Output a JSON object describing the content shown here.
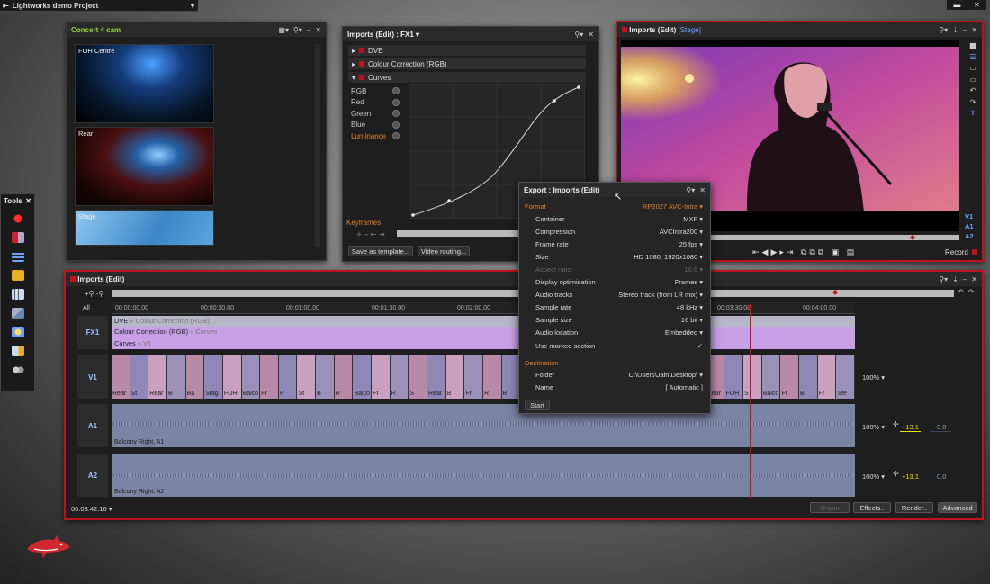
{
  "app": {
    "project_title": "Lightworks demo Project"
  },
  "colors": {
    "accent_red": "#c0121c",
    "orange": "#e0802a",
    "fx_purple": "#c9a0e8",
    "level_yellow": "#e6e600"
  },
  "concert": {
    "title": "Concert 4 cam",
    "tiles": [
      "FOH Centre",
      "Rear",
      "Stage"
    ]
  },
  "fxpanel": {
    "title": "Imports (Edit) : FX1",
    "effects": [
      "DVE",
      "Colour Correction (RGB)",
      "Curves"
    ],
    "channels": [
      "RGB",
      "Red",
      "Green",
      "Blue",
      "Luminance"
    ],
    "keyframes_label": "Keyframes",
    "buttons": [
      "Save as template...",
      "Video routing..."
    ]
  },
  "viewer": {
    "title": "Imports (Edit)",
    "stage_label": "[Stage]",
    "tracks": [
      "V1",
      "A1",
      "A2"
    ],
    "record_label": "Record"
  },
  "tools": {
    "title": "Tools"
  },
  "export": {
    "title": "Export : Imports (Edit)",
    "format_label": "Format",
    "format_value": "RP2027 AVC-Intra",
    "rows": [
      {
        "label": "Container",
        "value": "MXF"
      },
      {
        "label": "Compression",
        "value": "AVCIntra200"
      },
      {
        "label": "Frame rate",
        "value": "25 fps"
      },
      {
        "label": "Size",
        "value": "HD 1080, 1920x1080"
      },
      {
        "label": "Aspect ratio",
        "value": "16:9"
      },
      {
        "label": "Display optimisation",
        "value": "Frames"
      },
      {
        "label": "Audio tracks",
        "value": "Stereo track (from LR mix)"
      },
      {
        "label": "Sample rate",
        "value": "48 kHz"
      },
      {
        "label": "Sample size",
        "value": "16 bit"
      },
      {
        "label": "Audio location",
        "value": "Embedded"
      },
      {
        "label": "Use marked section",
        "value": "✓"
      }
    ],
    "destination_label": "Destination",
    "folder_label": "Folder",
    "folder_value": "C:\\Users\\Jain\\Desktop\\",
    "name_label": "Name",
    "name_value": "[ Automatic ]",
    "start_button": "Start"
  },
  "timeline": {
    "title": "Imports (Edit)",
    "ruler": [
      "00:00:00.00",
      "00:00:30.00",
      "00:01:00.00",
      "00:01:30.00",
      "00:02:00.00",
      "00:03:30.00",
      "00:04:00.00"
    ],
    "all_label": "All",
    "fx_track": {
      "label": "FX1",
      "rows": [
        {
          "name": "DVE",
          "detail": "« Colour Correction (RGB)"
        },
        {
          "name": "Colour Correction (RGB)",
          "detail": "« Curves"
        },
        {
          "name": "Curves",
          "detail": "« V1"
        }
      ]
    },
    "v1": {
      "label": "V1",
      "clips": [
        "Rear",
        "St",
        "Rear",
        "B",
        "Ba",
        "Stag",
        "FOH",
        "Balco",
        "Ff",
        "R",
        "St",
        "B",
        "R",
        "Balco",
        "Ff",
        "R",
        "S",
        "Rear",
        "B",
        "Ff",
        "R",
        "B",
        "FOH",
        "B",
        "B",
        "B",
        "Ff",
        "R",
        "Balco",
        "B",
        "S",
        "FOH",
        "Rear",
        "FOH",
        "S",
        "Balco",
        "Ff",
        "B",
        "Ff",
        "Ste"
      ],
      "zoom": "100%"
    },
    "a1": {
      "label": "A1",
      "clip": "Balcony Right, A1",
      "zoom": "100%",
      "level": "+13.1",
      "pan": "0.0"
    },
    "a2": {
      "label": "A2",
      "clip": "Balcony Right, A2",
      "zoom": "100%",
      "level": "+13.1",
      "pan": "0.0"
    },
    "timecode": "00:03:42.16",
    "buttons": {
      "unjoin": "Unjoin",
      "effects": "Effects..",
      "render": "Render..",
      "advanced": "Advanced"
    }
  }
}
